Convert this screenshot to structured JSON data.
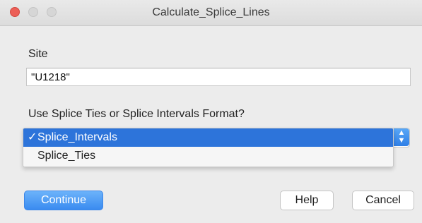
{
  "window": {
    "title": "Calculate_Splice_Lines"
  },
  "site": {
    "label": "Site",
    "value": "\"U1218\""
  },
  "format": {
    "label": "Use Splice Ties or Splice Intervals Format?",
    "options": [
      {
        "check": "✓",
        "label": "Splice_Intervals",
        "selected": true
      },
      {
        "check": "",
        "label": "Splice_Ties",
        "selected": false
      }
    ]
  },
  "buttons": {
    "continue": "Continue",
    "help": "Help",
    "cancel": "Cancel"
  },
  "colors": {
    "accent": "#2d74da",
    "close_light": "#ec5f57"
  }
}
